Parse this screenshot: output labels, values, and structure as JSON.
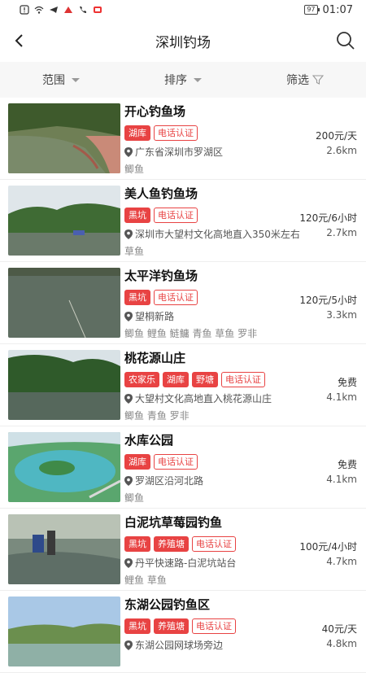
{
  "status": {
    "time": "01:07",
    "battery": "97"
  },
  "header": {
    "title": "深圳钓场"
  },
  "filters": {
    "range": "范围",
    "sort": "排序",
    "filter": "筛选"
  },
  "colors": {
    "accent": "#e84343"
  },
  "spots": [
    {
      "title": "开心钓鱼场",
      "tags": [
        {
          "text": "湖库",
          "style": "solid"
        },
        {
          "text": "电话认证",
          "style": "outline"
        }
      ],
      "price": "200元/天",
      "address": "广东省深圳市罗湖区",
      "distance": "2.6km",
      "fish": "鲫鱼"
    },
    {
      "title": "美人鱼钓鱼场",
      "tags": [
        {
          "text": "黑坑",
          "style": "solid"
        },
        {
          "text": "电话认证",
          "style": "outline"
        }
      ],
      "price": "120元/6小时",
      "address": "深圳市大望村文化高地直入350米左右",
      "distance": "2.7km",
      "fish": "草鱼"
    },
    {
      "title": "太平洋钓鱼场",
      "tags": [
        {
          "text": "黑坑",
          "style": "solid"
        },
        {
          "text": "电话认证",
          "style": "outline"
        }
      ],
      "price": "120元/5小时",
      "address": "望桐新路",
      "distance": "3.3km",
      "fish": "鲫鱼 鲤鱼 鲢鳙 青鱼 草鱼 罗非"
    },
    {
      "title": "桃花源山庄",
      "tags": [
        {
          "text": "农家乐",
          "style": "solid"
        },
        {
          "text": "湖库",
          "style": "solid"
        },
        {
          "text": "野塘",
          "style": "solid"
        },
        {
          "text": "电话认证",
          "style": "outline"
        }
      ],
      "price": "免费",
      "address": "大望村文化高地直入桃花源山庄",
      "distance": "4.1km",
      "fish": "鲫鱼 青鱼 罗非"
    },
    {
      "title": "水库公园",
      "tags": [
        {
          "text": "湖库",
          "style": "solid"
        },
        {
          "text": "电话认证",
          "style": "outline"
        }
      ],
      "price": "免费",
      "address": "罗湖区沿河北路",
      "distance": "4.1km",
      "fish": "鲫鱼"
    },
    {
      "title": "白泥坑草莓园钓鱼",
      "tags": [
        {
          "text": "黑坑",
          "style": "solid"
        },
        {
          "text": "养殖塘",
          "style": "solid"
        },
        {
          "text": "电话认证",
          "style": "outline"
        }
      ],
      "price": "100元/4小时",
      "address": "丹平快速路-白泥坑站台",
      "distance": "4.7km",
      "fish": "鲤鱼 草鱼"
    },
    {
      "title": "东湖公园钓鱼区",
      "tags": [
        {
          "text": "黑坑",
          "style": "solid"
        },
        {
          "text": "养殖塘",
          "style": "solid"
        },
        {
          "text": "电话认证",
          "style": "outline"
        }
      ],
      "price": "40元/天",
      "address": "东湖公园网球场旁边",
      "distance": "4.8km",
      "fish": ""
    }
  ]
}
